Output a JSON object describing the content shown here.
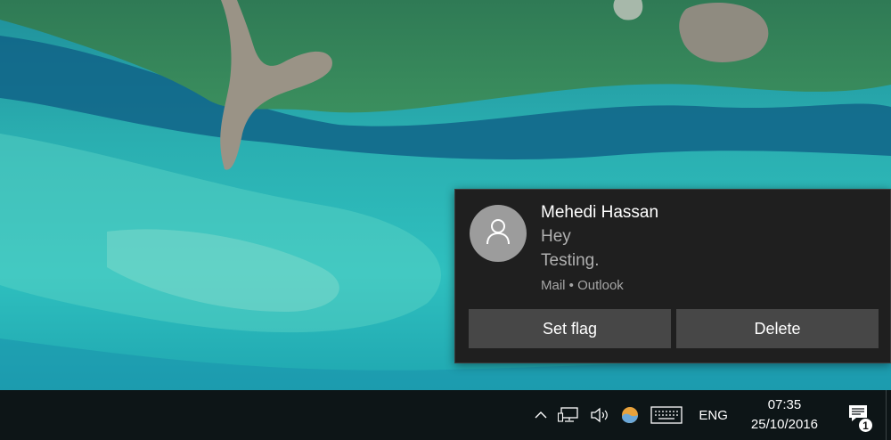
{
  "notification": {
    "sender": "Mehedi Hassan",
    "line1": "Hey",
    "line2": "Testing.",
    "source": "Mail • Outlook",
    "avatar_icon": "person-icon",
    "actions": [
      {
        "label": "Set flag"
      },
      {
        "label": "Delete"
      }
    ]
  },
  "taskbar": {
    "tray_icons": [
      "chevron-up-icon",
      "network-icon",
      "volume-icon",
      "weather-icon",
      "keyboard-icon"
    ],
    "language": "ENG",
    "clock": {
      "time": "07:35",
      "date": "25/10/2016"
    },
    "action_center": {
      "icon": "action-center-icon",
      "count": "1"
    }
  },
  "colors": {
    "toast_bg": "#1f1f1f",
    "button_bg": "#474747",
    "taskbar_bg": "#0d1517",
    "avatar_bg": "#9c9c9c"
  }
}
